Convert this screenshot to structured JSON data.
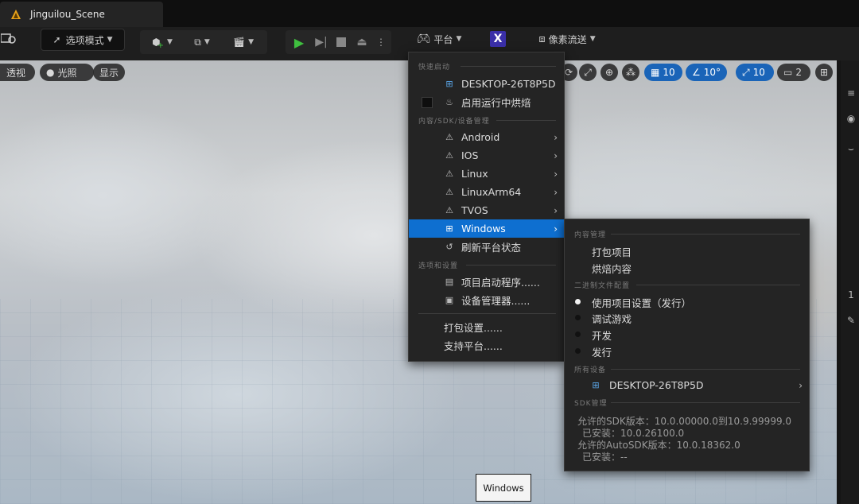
{
  "window": {
    "tab_title": "Jinguilou_Scene"
  },
  "toolbar": {
    "mode_label": "选项模式",
    "platform_label": "平台",
    "pixel_streaming_label": "像素流送",
    "hub_letter": "X"
  },
  "viewport": {
    "perspective_label": "透视",
    "lit_label": "光照",
    "show_label": "显示",
    "grid_snap_value": "10",
    "rotation_snap_value": "10°",
    "scale_snap_value": "10",
    "camera_speed_value": "2"
  },
  "right_panel": {
    "number_fragment": "1"
  },
  "platform_menu": {
    "section_quick_launch": "快速启动",
    "quick_launch_device": "DESKTOP-26T8P5D",
    "enable_live_cook": "启用运行中烘焙",
    "section_content": "内容/SDK/设备管理",
    "platforms": [
      {
        "label": "Android",
        "icon": "warning-icon"
      },
      {
        "label": "IOS",
        "icon": "warning-icon"
      },
      {
        "label": "Linux",
        "icon": "warning-icon"
      },
      {
        "label": "LinuxArm64",
        "icon": "warning-icon"
      },
      {
        "label": "TVOS",
        "icon": "warning-icon"
      },
      {
        "label": "Windows",
        "icon": "windows-icon"
      }
    ],
    "refresh_status": "刷新平台状态",
    "section_options": "选项和设置",
    "project_launcher": "项目启动程序......",
    "device_manager": "设备管理器......",
    "packaging_settings": "打包设置......",
    "supported_platforms": "支持平台......"
  },
  "windows_submenu": {
    "section_content_mgmt": "内容管理",
    "package_project": "打包项目",
    "cook_content": "烘焙内容",
    "section_binary_config": "二进制文件配置",
    "configs": [
      {
        "label": "使用项目设置（发行）",
        "selected": true
      },
      {
        "label": "调试游戏",
        "selected": false
      },
      {
        "label": "开发",
        "selected": false
      },
      {
        "label": "发行",
        "selected": false
      }
    ],
    "section_all_devices": "所有设备",
    "device": "DESKTOP-26T8P5D",
    "section_sdk": "SDK管理",
    "sdk_allowed": "允许的SDK版本：10.0.00000.0到10.9.99999.0",
    "sdk_installed": "已安装：10.0.26100.0",
    "autosdk_allowed": "允许的AutoSDK版本：10.0.18362.0",
    "autosdk_installed": "已安装：--"
  },
  "tooltip": {
    "text": "Windows"
  },
  "colors": {
    "accent": "#0e6fd0",
    "play_green": "#3fbf3f",
    "menu_bg": "#242424"
  }
}
